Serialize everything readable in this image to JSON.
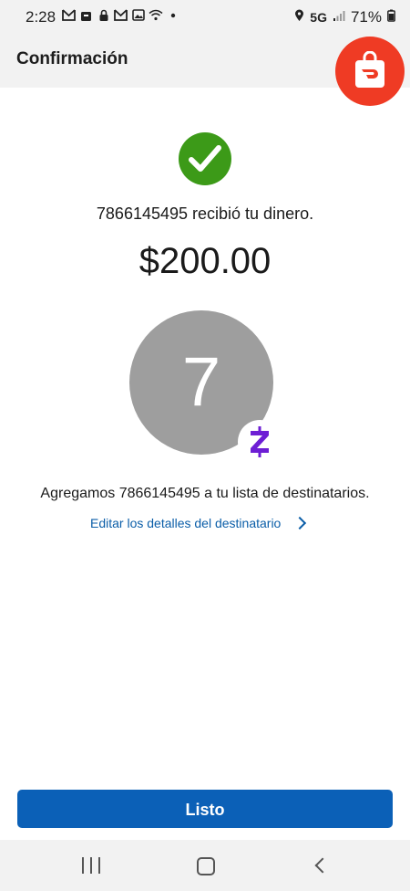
{
  "status_bar": {
    "time": "2:28",
    "left_icons": [
      "gmail-icon",
      "store-icon",
      "lock-icon",
      "gmail-icon",
      "image-icon",
      "wifi-icon",
      "dot-icon"
    ],
    "network": "5G",
    "battery": "71%"
  },
  "header": {
    "title": "Confirmación"
  },
  "main": {
    "received_text": "7866145495 recibió tu dinero.",
    "amount": "$200.00",
    "avatar_initial": "7",
    "added_text": "Agregamos 7866145495 a tu lista de destinatarios.",
    "edit_link": "Editar los detalles del destinatario"
  },
  "actions": {
    "done_label": "Listo"
  },
  "colors": {
    "success": "#3c9a18",
    "primary": "#0b60b7",
    "zelle_purple": "#6d1ed4",
    "doordash_red": "#ef3b24"
  }
}
